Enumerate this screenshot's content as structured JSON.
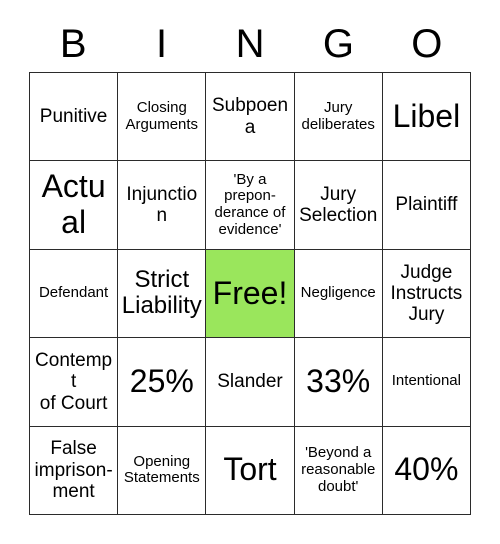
{
  "card": {
    "title": "BINGO",
    "header_letters": [
      "B",
      "I",
      "N",
      "G",
      "O"
    ],
    "free_space_color": "#9ae65c",
    "border_color": "#2b2b2b",
    "background_color": "#ffffff",
    "rows": 5,
    "columns": 5,
    "cells": [
      [
        {
          "text": "Punitive",
          "size": "md",
          "free": false
        },
        {
          "text": "Closing\nArguments",
          "size": "sm",
          "free": false
        },
        {
          "text": "Subpoena",
          "size": "md",
          "free": false
        },
        {
          "text": "Jury\ndeliberates",
          "size": "sm",
          "free": false
        },
        {
          "text": "Libel",
          "size": "xl",
          "free": false
        }
      ],
      [
        {
          "text": "Actual",
          "size": "xl",
          "free": false
        },
        {
          "text": "Injunction",
          "size": "md",
          "free": false
        },
        {
          "text": "'By a\nprepon-\nderance of\nevidence'",
          "size": "sm",
          "free": false
        },
        {
          "text": "Jury\nSelection",
          "size": "md",
          "free": false
        },
        {
          "text": "Plaintiff",
          "size": "md",
          "free": false
        }
      ],
      [
        {
          "text": "Defendant",
          "size": "sm",
          "free": false
        },
        {
          "text": "Strict\nLiability",
          "size": "lg",
          "free": false
        },
        {
          "text": "Free!",
          "size": "xl",
          "free": true
        },
        {
          "text": "Negligence",
          "size": "sm",
          "free": false
        },
        {
          "text": "Judge\nInstructs\nJury",
          "size": "md",
          "free": false
        }
      ],
      [
        {
          "text": "Contempt\nof Court",
          "size": "md",
          "free": false
        },
        {
          "text": "25%",
          "size": "xl",
          "free": false
        },
        {
          "text": "Slander",
          "size": "md",
          "free": false
        },
        {
          "text": "33%",
          "size": "xl",
          "free": false
        },
        {
          "text": "Intentional",
          "size": "sm",
          "free": false
        }
      ],
      [
        {
          "text": "False\nimprison-\nment",
          "size": "md",
          "free": false
        },
        {
          "text": "Opening\nStatements",
          "size": "sm",
          "free": false
        },
        {
          "text": "Tort",
          "size": "xl",
          "free": false
        },
        {
          "text": "'Beyond a\nreasonable\ndoubt'",
          "size": "sm",
          "free": false
        },
        {
          "text": "40%",
          "size": "xl",
          "free": false
        }
      ]
    ]
  }
}
